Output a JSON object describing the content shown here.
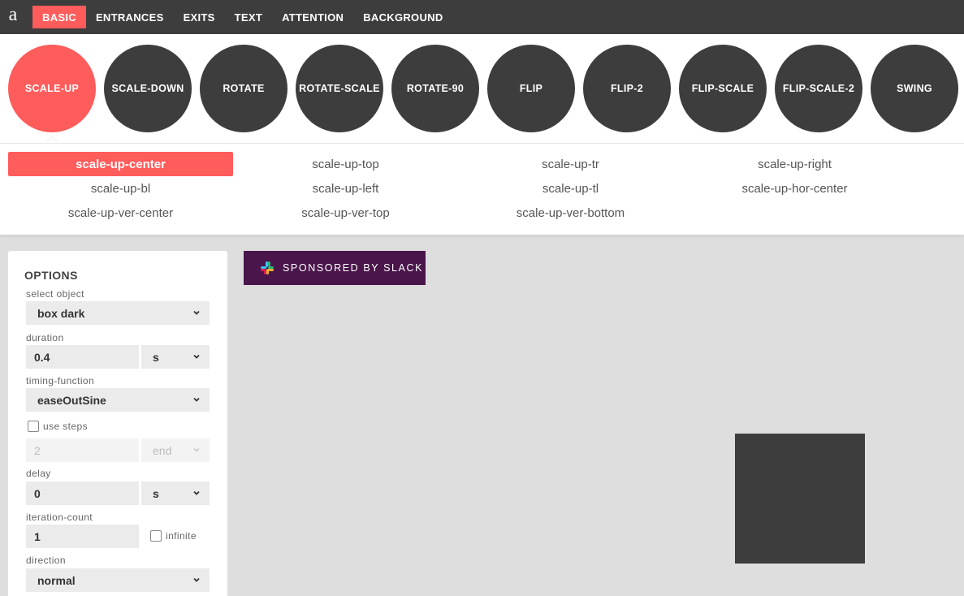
{
  "nav": {
    "logo": "a",
    "tabs": [
      "BASIC",
      "ENTRANCES",
      "EXITS",
      "TEXT",
      "ATTENTION",
      "BACKGROUND"
    ],
    "active_tab": "BASIC"
  },
  "animations": [
    "SCALE-UP",
    "SCALE-DOWN",
    "ROTATE",
    "ROTATE-SCALE",
    "ROTATE-90",
    "FLIP",
    "FLIP-2",
    "FLIP-SCALE",
    "FLIP-SCALE-2",
    "SWING"
  ],
  "active_animation": "SCALE-UP",
  "variants": [
    "scale-up-center",
    "scale-up-top",
    "scale-up-tr",
    "scale-up-right",
    "scale-up-bl",
    "scale-up-left",
    "scale-up-tl",
    "scale-up-hor-center",
    "scale-up-ver-center",
    "scale-up-ver-top",
    "scale-up-ver-bottom"
  ],
  "active_variant": "scale-up-center",
  "options": {
    "title": "OPTIONS",
    "select_object_label": "select object",
    "select_object_value": "box dark",
    "duration_label": "duration",
    "duration_value": "0.4",
    "duration_unit": "s",
    "timing_label": "timing-function",
    "timing_value": "easeOutSine",
    "use_steps_label": "use steps",
    "use_steps_checked": false,
    "steps_value": "2",
    "steps_direction": "end",
    "delay_label": "delay",
    "delay_value": "0",
    "delay_unit": "s",
    "iteration_label": "iteration-count",
    "iteration_value": "1",
    "infinite_label": "infinite",
    "infinite_checked": false,
    "direction_label": "direction",
    "direction_value": "normal"
  },
  "sponsor": {
    "label": "SPONSORED BY SLACK"
  },
  "colors": {
    "accent": "#ff5c5c",
    "dark": "#3d3d3d",
    "slack": "#4a154b",
    "stage": "#dedede"
  }
}
